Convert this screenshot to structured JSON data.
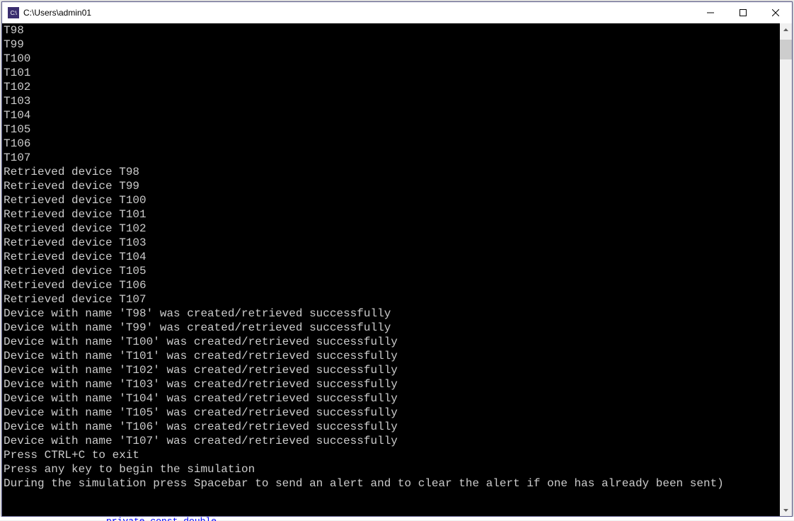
{
  "window": {
    "icon_text": "C:\\",
    "title": "C:\\Users\\admin01"
  },
  "console_lines": [
    "T98",
    "T99",
    "T100",
    "T101",
    "T102",
    "T103",
    "T104",
    "T105",
    "T106",
    "T107",
    "Retrieved device T98",
    "Retrieved device T99",
    "Retrieved device T100",
    "Retrieved device T101",
    "Retrieved device T102",
    "Retrieved device T103",
    "Retrieved device T104",
    "Retrieved device T105",
    "Retrieved device T106",
    "Retrieved device T107",
    "Device with name 'T98' was created/retrieved successfully",
    "Device with name 'T99' was created/retrieved successfully",
    "Device with name 'T100' was created/retrieved successfully",
    "Device with name 'T101' was created/retrieved successfully",
    "Device with name 'T102' was created/retrieved successfully",
    "Device with name 'T103' was created/retrieved successfully",
    "Device with name 'T104' was created/retrieved successfully",
    "Device with name 'T105' was created/retrieved successfully",
    "Device with name 'T106' was created/retrieved successfully",
    "Device with name 'T107' was created/retrieved successfully",
    "Press CTRL+C to exit",
    "Press any key to begin the simulation",
    "During the simulation press Spacebar to send an alert and to clear the alert if one has already been sent)"
  ],
  "code_fragment": "private const double"
}
